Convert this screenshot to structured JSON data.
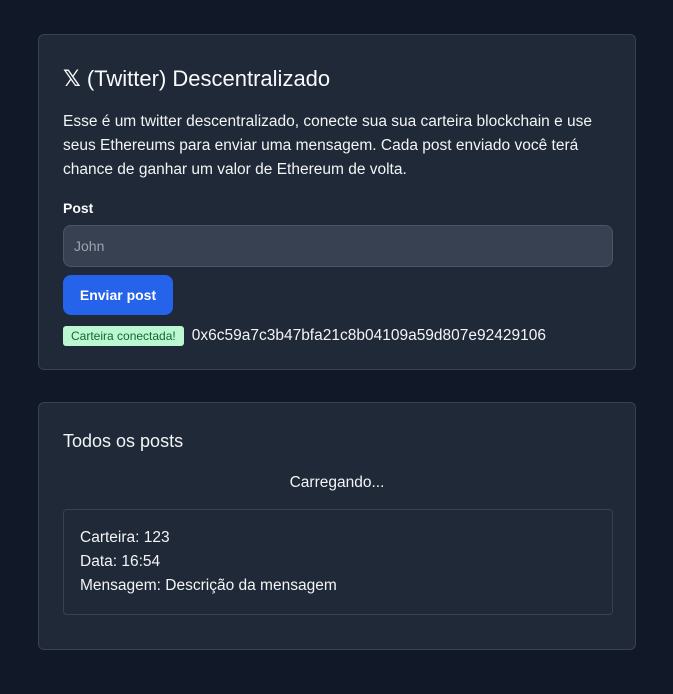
{
  "header": {
    "icon_glyph": "𝕏",
    "title": " (Twitter) Descentralizado",
    "description": "Esse é um twitter descentralizado, conecte sua sua carteira blockchain e use seus Ethereums para enviar uma mensagem. Cada post enviado você terá chance de ganhar um valor de Ethereum de volta."
  },
  "form": {
    "post_label": "Post",
    "post_placeholder": "John",
    "post_value": "",
    "submit_label": "Enviar post"
  },
  "wallet": {
    "status_badge": "Carteira conectada!",
    "address": "0x6c59a7c3b47bfa21c8b04109a59d807e92429106"
  },
  "posts_section": {
    "title": "Todos os posts",
    "loading_text": "Carregando...",
    "posts": [
      {
        "wallet_line": "Carteira: 123",
        "date_line": "Data: 16:54",
        "message_line": "Mensagem: Descrição da mensagem"
      }
    ]
  },
  "colors": {
    "background": "#111827",
    "card": "#1f2937",
    "accent": "#2563eb",
    "badge_bg": "#bbf7d0",
    "badge_text": "#166534"
  }
}
